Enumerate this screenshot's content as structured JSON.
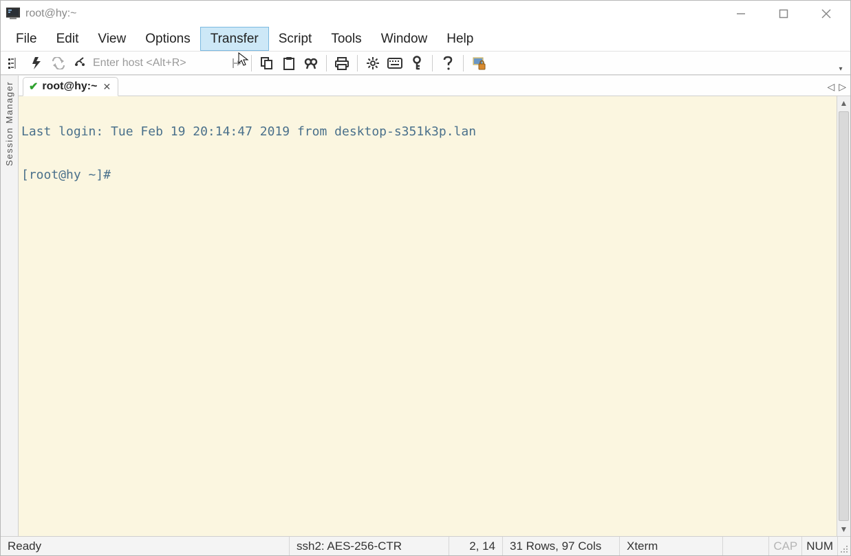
{
  "window": {
    "title": "root@hy:~"
  },
  "menu": {
    "items": [
      "File",
      "Edit",
      "View",
      "Options",
      "Transfer",
      "Script",
      "Tools",
      "Window",
      "Help"
    ],
    "highlighted_index": 4
  },
  "toolbar": {
    "host_placeholder": "Enter host <Alt+R>"
  },
  "sidebar": {
    "label": "Session Manager"
  },
  "tabs": {
    "active": {
      "label": "root@hy:~"
    }
  },
  "terminal": {
    "lines": [
      "Last login: Tue Feb 19 20:14:47 2019 from desktop-s351k3p.lan",
      "[root@hy ~]#"
    ]
  },
  "status": {
    "ready": "Ready",
    "conn": "ssh2: AES-256-CTR",
    "cursor": "2,  14",
    "size": "31 Rows, 97 Cols",
    "term": "Xterm",
    "cap": "CAP",
    "num": "NUM"
  }
}
